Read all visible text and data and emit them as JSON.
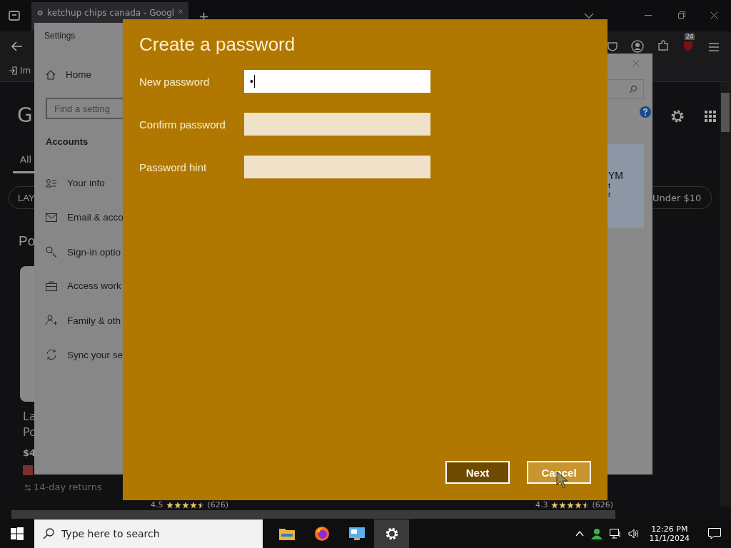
{
  "browser": {
    "tab": {
      "title": "ketchup chips canada - Googl",
      "selected": true
    },
    "new_tab": "+",
    "bookmark": "Im",
    "logo_letter": "G",
    "notification_badge": "24",
    "search_tab": "All",
    "chips": [
      "LAY",
      "Under $10"
    ],
    "heading": "Po",
    "product": {
      "title_lines": [
        "La",
        "Po"
      ],
      "price": "$4",
      "returns": "14-day returns"
    },
    "ratings": [
      {
        "score": "4.5",
        "stars": 4.5,
        "count": "(626)"
      },
      {
        "score": "4.3",
        "stars": 4.5,
        "count": "(626)"
      }
    ]
  },
  "settings": {
    "title": "Settings",
    "home": "Home",
    "search": {
      "placeholder": "Find a setting"
    },
    "section": "Accounts",
    "items": [
      {
        "kind": "info",
        "label": "Your info"
      },
      {
        "kind": "mail",
        "label": "Email & acco"
      },
      {
        "kind": "key",
        "label": "Sign-in optio"
      },
      {
        "kind": "work",
        "label": "Access work"
      },
      {
        "kind": "family",
        "label": "Family & oth"
      },
      {
        "kind": "sync",
        "label": "Sync your se"
      }
    ]
  },
  "account_window": {
    "fragments": [
      "YM",
      "t",
      "r"
    ]
  },
  "dialog": {
    "title": "Create a password",
    "fields": [
      {
        "label": "New password",
        "value": "•",
        "focused": true
      },
      {
        "label": "Confirm password",
        "focused": false
      },
      {
        "label": "Password hint",
        "focused": false
      }
    ],
    "buttons": [
      {
        "label": "Next",
        "kind": "primary"
      },
      {
        "label": "Cancel",
        "kind": "secondary"
      }
    ]
  },
  "taskbar": {
    "search": {
      "placeholder": "Type here to search"
    },
    "apps": [
      {
        "kind": "folder",
        "selected": false
      },
      {
        "kind": "firefox",
        "selected": false
      },
      {
        "kind": "remote",
        "selected": false
      },
      {
        "kind": "settings",
        "selected": true
      }
    ],
    "time": "12:26 PM",
    "date": "11/1/2024"
  }
}
